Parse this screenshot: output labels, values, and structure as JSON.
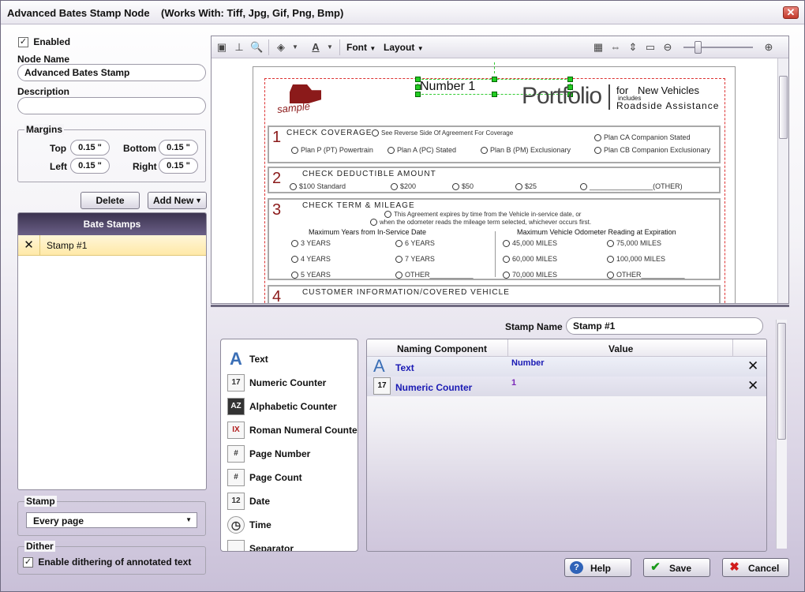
{
  "window": {
    "title": "Advanced Bates Stamp Node    (Works With: Tiff, Jpg, Gif, Png, Bmp)",
    "close": "✕"
  },
  "left": {
    "enabled_label": "Enabled",
    "enabled_check": "✓",
    "node_name_label": "Node Name",
    "node_name_value": "Advanced Bates Stamp",
    "description_label": "Description",
    "description_value": "",
    "margins": {
      "label": "Margins",
      "top_label": "Top",
      "top": "0.15 \"",
      "bottom_label": "Bottom",
      "bottom": "0.15 \"",
      "left_label": "Left",
      "left": "0.15 \"",
      "right_label": "Right",
      "right": "0.15 \""
    },
    "delete_button": "Delete",
    "add_new_button": "Add New",
    "bate_stamps": {
      "header": "Bate Stamps",
      "items": [
        {
          "label": "Stamp #1"
        }
      ]
    },
    "stamp": {
      "label": "Stamp",
      "value": "Every page"
    },
    "dither": {
      "label": "Dither",
      "option": "Enable dithering of annotated text",
      "check": "✓"
    }
  },
  "toolbar": {
    "font_label": "Font",
    "layout_label": "Layout",
    "zoom_percent": 20
  },
  "document": {
    "stamp_preview": "Number 1",
    "logo_text": "sample",
    "brand": {
      "portfolio": "Portfolio",
      "for": "for",
      "new_vehicles": "New Vehicles",
      "includes": "includes",
      "roadside": "Roadside Assistance"
    },
    "sections": [
      {
        "num": "1",
        "title": "CHECK COVERAGE",
        "subtitle": "See Reverse Side Of Agreement For Coverage",
        "options": [
          "Plan P (PT) Powertrain",
          "Plan A (PC) Stated",
          "Plan B (PM) Exclusionary",
          "Plan CA Companion Stated",
          "Plan CB Companion Exclusionary"
        ]
      },
      {
        "num": "2",
        "title": "CHECK DEDUCTIBLE AMOUNT",
        "options": [
          "$100 Standard",
          "$200",
          "$50",
          "$25",
          "________________(OTHER)"
        ]
      },
      {
        "num": "3",
        "title": "CHECK TERM & MILEAGE",
        "line1": "This Agreement expires by time from the Vehicle in-service date, or",
        "line2": "when the odometer reads the mileage term selected, whichever occurs first.",
        "col1_head": "Maximum Years from In-Service Date",
        "col2_head": "Maximum Vehicle Odometer Reading at Expiration",
        "years": [
          "3 YEARS",
          "6 YEARS",
          "4 YEARS",
          "7 YEARS",
          "5 YEARS",
          "OTHER___________"
        ],
        "miles": [
          "45,000 MILES",
          "75,000 MILES",
          "60,000 MILES",
          "100,000 MILES",
          "70,000 MILES",
          "OTHER___________"
        ]
      },
      {
        "num": "4",
        "title": "CUSTOMER INFORMATION/COVERED VEHICLE"
      }
    ]
  },
  "stamp_name": {
    "label": "Stamp Name",
    "value": "Stamp #1"
  },
  "components": [
    {
      "label": "Text",
      "icon": "A"
    },
    {
      "label": "Numeric Counter",
      "icon": "17"
    },
    {
      "label": "Alphabetic Counter",
      "icon": "AZ"
    },
    {
      "label": "Roman Numeral Counter",
      "icon": "IX"
    },
    {
      "label": "Page Number",
      "icon": "#"
    },
    {
      "label": "Page Count",
      "icon": "#"
    },
    {
      "label": "Date",
      "icon": "12"
    },
    {
      "label": "Time",
      "icon": "◷"
    },
    {
      "label": "Separator",
      "icon": ""
    }
  ],
  "naming": {
    "col1": "Naming Component",
    "col2": "Value",
    "rows": [
      {
        "component": "Text",
        "value": "Number",
        "icon": "A"
      },
      {
        "component": "Numeric Counter",
        "value": "1",
        "icon": "17"
      }
    ]
  },
  "buttons": {
    "help": "Help",
    "save": "Save",
    "cancel": "Cancel",
    "help_icon": "?",
    "save_icon": "✔",
    "cancel_icon": "✖"
  },
  "colors": {
    "accent": "#3b3350",
    "link_blue": "#1a1ab4",
    "value_purple": "#7a28b8"
  }
}
